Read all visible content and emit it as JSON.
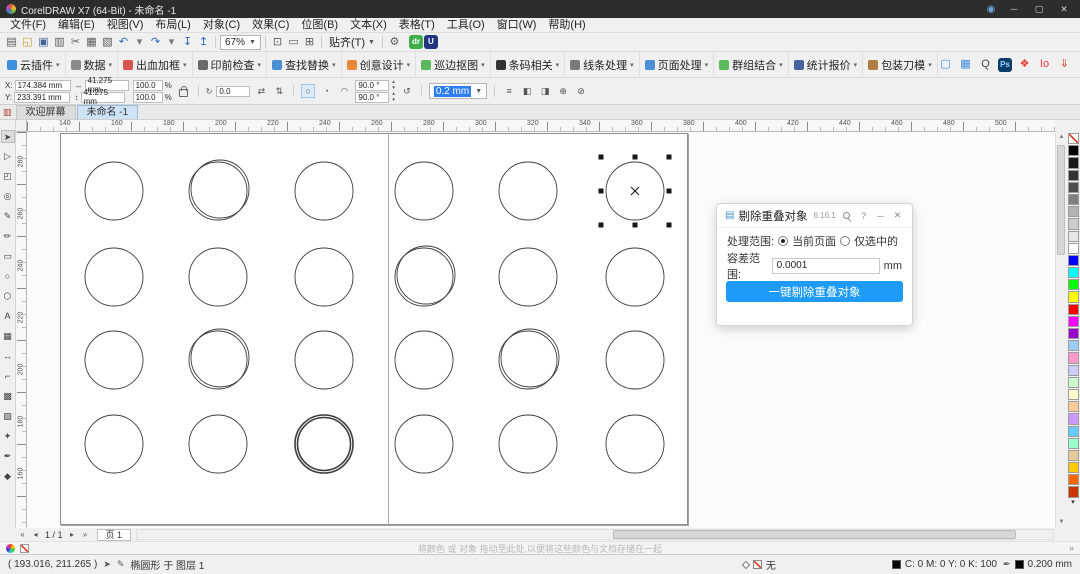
{
  "window": {
    "title": "CorelDRAW X7 (64-Bit) - 未命名 -1"
  },
  "menu": [
    "文件(F)",
    "编辑(E)",
    "视图(V)",
    "布局(L)",
    "对象(C)",
    "效果(C)",
    "位图(B)",
    "文本(X)",
    "表格(T)",
    "工具(O)",
    "窗口(W)",
    "帮助(H)"
  ],
  "std_toolbar": {
    "icons_left": [
      {
        "name": "new-document-icon",
        "glyph": "▤",
        "color": "#5a5a5a"
      },
      {
        "name": "open-icon",
        "glyph": "◱",
        "color": "#c8a13a"
      },
      {
        "name": "save-icon",
        "glyph": "▣",
        "color": "#46639e"
      },
      {
        "name": "print-icon",
        "glyph": "▥",
        "color": "#5a5a5a"
      },
      {
        "name": "cut-icon",
        "glyph": "✂",
        "color": "#5a5a5a"
      },
      {
        "name": "copy-icon",
        "glyph": "▦",
        "color": "#5a5a5a"
      },
      {
        "name": "paste-icon",
        "glyph": "▧",
        "color": "#5a5a5a"
      },
      {
        "name": "undo-icon",
        "glyph": "↶",
        "color": "#2f66c0"
      },
      {
        "name": "undo-dropdown-icon",
        "glyph": "▾",
        "color": "#777777"
      },
      {
        "name": "redo-icon",
        "glyph": "↷",
        "color": "#2f66c0"
      },
      {
        "name": "redo-dropdown-icon",
        "glyph": "▾",
        "color": "#777777"
      },
      {
        "name": "import-icon",
        "glyph": "↧",
        "color": "#2f66c0"
      },
      {
        "name": "export-icon",
        "glyph": "↥",
        "color": "#2f66c0"
      }
    ],
    "zoom_value": "67%",
    "icons_middle": [
      {
        "name": "fullscreen-preview-icon",
        "glyph": "⊡",
        "color": "#5a5a5a"
      },
      {
        "name": "show-rulers-icon",
        "glyph": "▭",
        "color": "#5a5a5a"
      },
      {
        "name": "show-grid-icon",
        "glyph": "⊞",
        "color": "#5a5a5a"
      }
    ],
    "snap_label": "贴齐(T)",
    "icons_right": [
      {
        "name": "options-icon",
        "glyph": "⚙",
        "color": "#5a5a5a"
      }
    ],
    "app_badges": [
      {
        "name": "coreldraw-app-icon",
        "glyph": "dr",
        "bg": "#3fae49",
        "color": "#ffffff"
      },
      {
        "name": "corel-guide-icon",
        "glyph": "U",
        "bg": "#24357f",
        "color": "#ffffff"
      }
    ]
  },
  "plugin_toolbar": {
    "items": [
      {
        "label": "云插件",
        "color": "#3b8de0"
      },
      {
        "label": "数据",
        "color": "#8a8a8a"
      },
      {
        "label": "出血加框",
        "color": "#d9534f"
      },
      {
        "label": "印前检查",
        "color": "#6a6a6a"
      },
      {
        "label": "查找替换",
        "color": "#4a90d2"
      },
      {
        "label": "创意设计",
        "color": "#e8883a"
      },
      {
        "label": "巡边抠图",
        "color": "#5cb85c"
      },
      {
        "label": "条码相关",
        "color": "#333333"
      },
      {
        "label": "线条处理",
        "color": "#7a7a7a"
      },
      {
        "label": "页面处理",
        "color": "#4a90d2"
      },
      {
        "label": "群组结合",
        "color": "#5cb85c"
      },
      {
        "label": "统计报价",
        "color": "#46639e"
      },
      {
        "label": "包装刀模",
        "color": "#b07d3f"
      }
    ],
    "right_icons": [
      {
        "name": "capture-icon",
        "glyph": "▢",
        "color": "#3b8de0"
      },
      {
        "name": "clipboard-icon",
        "glyph": "▦",
        "color": "#3b8de0"
      },
      {
        "name": "search-icon",
        "glyph": "Q",
        "color": "#444444"
      },
      {
        "name": "photoshop-icon",
        "glyph": "Ps",
        "bg": "#0b3d6b",
        "color": "#9fd4ff"
      },
      {
        "name": "footprint-icon",
        "glyph": "❖",
        "color": "#e03c31"
      },
      {
        "name": "io-icon",
        "glyph": "Io",
        "color": "#e03c31"
      },
      {
        "name": "download-icon",
        "glyph": "⇓",
        "color": "#e03c31"
      }
    ]
  },
  "property_bar": {
    "x_label": "X:",
    "x_value": "174.384 mm",
    "y_label": "Y:",
    "y_value": "233.391 mm",
    "width_value": "41.275 mm",
    "height_value": "41.275 mm",
    "scale_x_value": "100.0",
    "scale_y_value": "100.0",
    "percent_label": "%",
    "rotation_value": "0.0",
    "start_angle_value": "90.0",
    "end_angle_value": "90.0",
    "degree_label": "°",
    "outline_width_value": "0.2 mm"
  },
  "doc_tabs": [
    {
      "label": "欢迎屏幕",
      "active": false
    },
    {
      "label": "未命名 -1",
      "active": true
    }
  ],
  "rulers": {
    "h_numbers": [
      140,
      160,
      180,
      200,
      220,
      240,
      260,
      280,
      300,
      320,
      340,
      360,
      380,
      400,
      420,
      440,
      460,
      480,
      500
    ],
    "v_numbers": [
      280,
      260,
      240,
      220,
      200,
      180,
      160
    ]
  },
  "toolbox": [
    {
      "name": "pick-tool",
      "glyph": "➤",
      "active": true
    },
    {
      "name": "shape-tool",
      "glyph": "▷",
      "active": false
    },
    {
      "name": "crop-tool",
      "glyph": "◰",
      "active": false
    },
    {
      "name": "zoom-tool",
      "glyph": "◎",
      "active": false
    },
    {
      "name": "freehand-tool",
      "glyph": "✎",
      "active": false
    },
    {
      "name": "artistic-media-tool",
      "glyph": "✏",
      "active": false
    },
    {
      "name": "rectangle-tool",
      "glyph": "▭",
      "active": false
    },
    {
      "name": "ellipse-tool",
      "glyph": "○",
      "active": false
    },
    {
      "name": "polygon-tool",
      "glyph": "⬡",
      "active": false
    },
    {
      "name": "text-tool",
      "glyph": "A",
      "active": false
    },
    {
      "name": "table-tool",
      "glyph": "▦",
      "active": false
    },
    {
      "name": "dimension-tool",
      "glyph": "↔",
      "active": false
    },
    {
      "name": "connector-tool",
      "glyph": "⌐",
      "active": false
    },
    {
      "name": "drop-shadow-tool",
      "glyph": "▩",
      "active": false
    },
    {
      "name": "transparency-tool",
      "glyph": "▨",
      "active": false
    },
    {
      "name": "color-eyedropper-tool",
      "glyph": "✦",
      "active": false
    },
    {
      "name": "outline-pen-tool",
      "glyph": "✒",
      "active": false
    },
    {
      "name": "interactive-fill-tool",
      "glyph": "◆",
      "active": false
    }
  ],
  "canvas": {
    "circle_grid": {
      "cols": [
        87,
        191,
        297,
        397,
        501,
        608
      ],
      "rows": [
        59,
        145,
        228,
        312
      ],
      "radius": 29,
      "double": [
        [
          1,
          0
        ],
        [
          3,
          1
        ],
        [
          1,
          2
        ],
        [
          4,
          2
        ]
      ],
      "thick": [
        [
          2,
          3
        ]
      ],
      "selected": [
        5,
        0
      ]
    }
  },
  "dialog": {
    "title": "剔除重叠对象",
    "version": "6.16.1",
    "scope_label": "处理范围:",
    "radio_current": "当前页面",
    "radio_selected": "仅选中的",
    "tolerance_label": "容差范围:",
    "tolerance_value": "0.0001",
    "unit_label": "mm",
    "action_label": "一键剔除重叠对象"
  },
  "palette": {
    "colors": [
      "none",
      "#000000",
      "#1a1a1a",
      "#333333",
      "#4d4d4d",
      "#808080",
      "#b3b3b3",
      "#cccccc",
      "#e6e6e6",
      "#ffffff",
      "#0000ff",
      "#00ffff",
      "#00ff00",
      "#ffff00",
      "#ff0000",
      "#ff00ff",
      "#9900cc",
      "#99ccff",
      "#ff99cc",
      "#ccccff",
      "#ccffcc",
      "#ffffcc",
      "#ffcc99",
      "#cc99ff",
      "#66ccff",
      "#99ffcc",
      "#e6cc99",
      "#ffcc00",
      "#ff6600",
      "#cc3300"
    ]
  },
  "bottom": {
    "page_nav": {
      "pages_label": "1 / 1",
      "page_tab_label": "页 1"
    },
    "palette_hint": "将颜色 或 对象 拖动至此处,以便将这些颜色与文档存储在一起",
    "status": {
      "coords": "( 193.016, 211.265 )",
      "object_info": "椭圆形 于 图层 1",
      "fill_none_label": "无",
      "fill_cmyk": "C: 0 M: 0 Y: 0 K: 100",
      "outline_value": "0.200 mm"
    }
  }
}
